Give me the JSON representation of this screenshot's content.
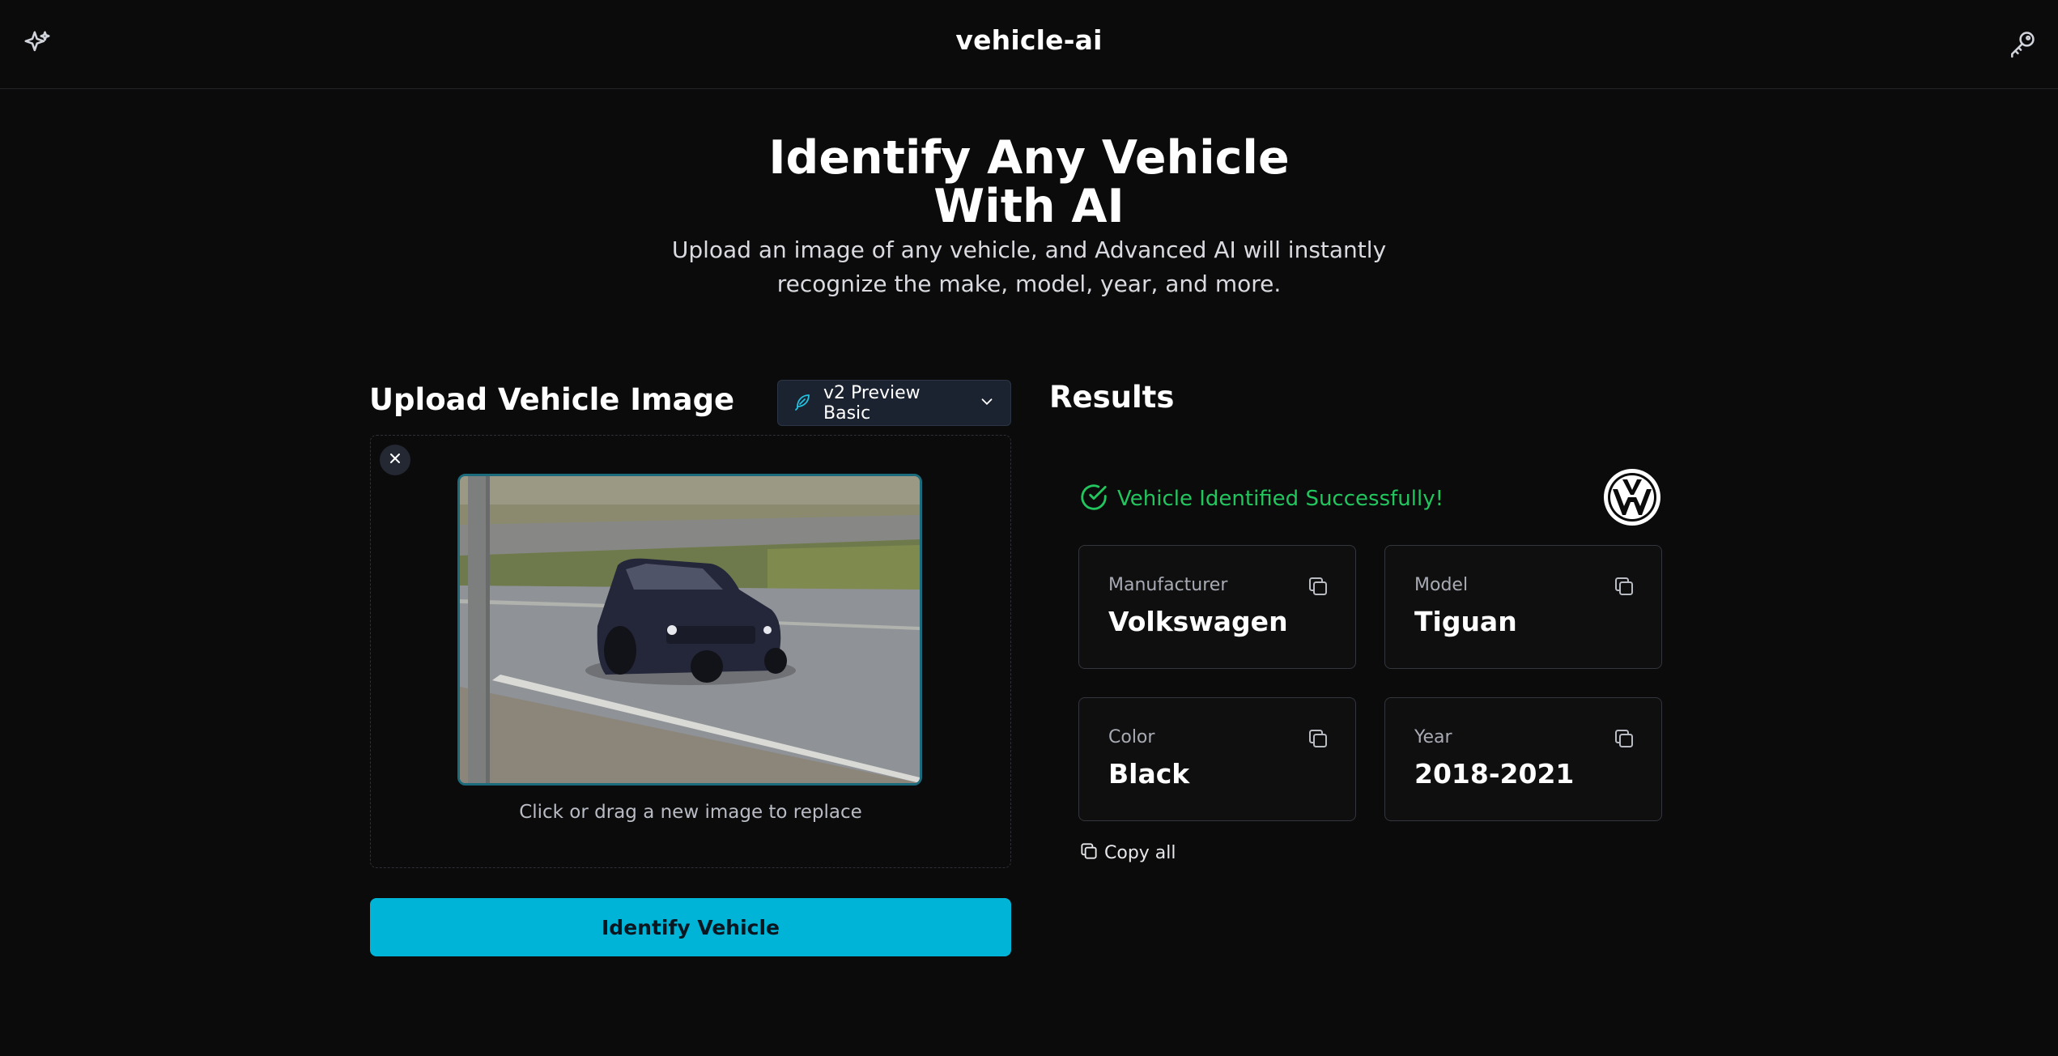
{
  "header": {
    "brand": "vehicle-ai",
    "left_icon": "sparkles-icon",
    "right_icon": "key-icon"
  },
  "hero": {
    "title_line1": "Identify Any Vehicle",
    "title_line2": "With AI",
    "subtitle": "Upload an image of any vehicle, and Advanced AI will instantly recognize the make, model, year, and more."
  },
  "upload": {
    "title": "Upload Vehicle Image",
    "model_select": {
      "selected": "v2 Preview Basic",
      "icon": "feather-icon"
    },
    "replace_hint": "Click or drag a new image to replace",
    "identify_button": "Identify Vehicle"
  },
  "results": {
    "title": "Results",
    "status": "Vehicle Identified Successfully!",
    "brand_logo": "volkswagen-logo",
    "fields": [
      {
        "key": "Manufacturer",
        "value": "Volkswagen"
      },
      {
        "key": "Model",
        "value": "Tiguan"
      },
      {
        "key": "Color",
        "value": "Black"
      },
      {
        "key": "Year",
        "value": "2018-2021"
      }
    ],
    "copy_all": "Copy all"
  },
  "colors": {
    "background": "#0b0b0b",
    "accent": "#00b4d8",
    "success": "#22c55e",
    "card_border": "#33363d"
  }
}
